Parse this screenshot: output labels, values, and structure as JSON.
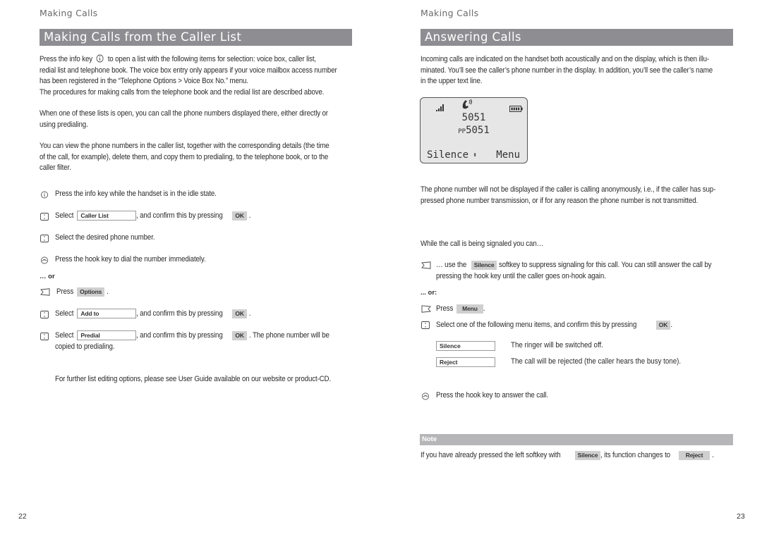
{
  "left_page": {
    "running_head": "Making Calls",
    "title": "Making Calls from the Caller List",
    "intro": {
      "line1_before_icon": "Press the info key",
      "line1_after_icon": "to open a list with the following items for selection: voice box, caller list,",
      "line2": "redial list and telephone book. The voice box entry only appears if your voice mailbox access number",
      "line3": "has been registered in the “Telephone Options > Voice Box No.” menu.",
      "line4": "The procedures for making calls from the telephone book and the redial list are described above."
    },
    "para2": {
      "line1": "When one of these lists is open, you can call the phone numbers displayed there, either directly or",
      "line2": "using predialing."
    },
    "para3": {
      "line1": "You can view the phone numbers in the caller list, together with the corresponding details (the time",
      "line2": "of the call, for example), delete them, and copy them to predialing, to the telephone book, or to the",
      "line3": "caller filter."
    },
    "steps": [
      {
        "icon": "info-key-icon",
        "text": "Press the info key while the handset is in the idle state."
      },
      {
        "icon": "nav-key-icon",
        "before": "Select",
        "field": "Caller List",
        "after": ", and confirm this by pressing",
        "key": "OK",
        "end": "."
      },
      {
        "icon": "nav-key-icon",
        "text": "Select the desired phone number."
      },
      {
        "icon": "hook-key-icon",
        "text": "Press the hook key to dial the number immediately."
      }
    ],
    "or_label": "… or",
    "alt_steps": [
      {
        "icon": "left-softkey-icon",
        "before": "Press",
        "key": "Options",
        "end": "."
      },
      {
        "icon": "nav-key-icon",
        "before": "Select",
        "field": "Add to",
        "after": ", and confirm this by pressing",
        "key": "OK",
        "end": "."
      },
      {
        "icon": "nav-key-icon",
        "before": "Select",
        "field": "Predial",
        "after": ", and confirm this by pressing",
        "key": "OK",
        "end": ". The phone number will be",
        "line2": "copied to predialing."
      }
    ],
    "footer_note": "For further list editing options, please see User Guide available on our website or product-CD.",
    "page_number": "22"
  },
  "right_page": {
    "running_head": "Making Calls",
    "title": "Answering Calls",
    "intro": {
      "line1": "Incoming calls are indicated on the handset both acoustically and on the display, which is then illu-",
      "line2": "minated. You’ll see the caller’s phone number in the display. In addition, you’ll see the caller’s name",
      "line3": "in the upper text line."
    },
    "display": {
      "icons": [
        "signal-strength-icon",
        "ringing-handset-icon",
        "battery-icon"
      ],
      "number": "5051",
      "name_prefix": "PP",
      "name_number": "5051",
      "left_softkey": "Silence",
      "nav_indicator": "⬍",
      "right_softkey": "Menu"
    },
    "anon": {
      "line1": "The phone number will not be displayed if the caller is calling anonymously, i.e., if the caller has sup-",
      "line2": "pressed phone number transmission, or if for any reason the phone number is not transmitted."
    },
    "while_signaled": "While the call is being signaled you can…",
    "silence_step": {
      "before": "… use the",
      "key": "Silence",
      "after": "softkey to suppress signaling for this call. You can still answer the call by",
      "line2": "pressing the hook key until the caller goes on-hook again."
    },
    "or_label": "... or:",
    "menu_step": {
      "before": "Press",
      "key": "Menu",
      "end": "."
    },
    "select_step": {
      "before": "Select one of the following menu items, and confirm this by pressing",
      "key": "OK",
      "end": "."
    },
    "options": [
      {
        "field": "Silence",
        "desc": "The ringer will be switched off."
      },
      {
        "field": "Reject",
        "desc": "The call will be rejected (the caller hears the busy tone)."
      }
    ],
    "hook_step": "Press the hook key to answer the call.",
    "note": {
      "label": "Note",
      "before": "If you have already pressed the left softkey with",
      "key1": "Silence",
      "middle": ", its function changes to",
      "key2": "Reject",
      "end": "."
    },
    "page_number": "23"
  }
}
